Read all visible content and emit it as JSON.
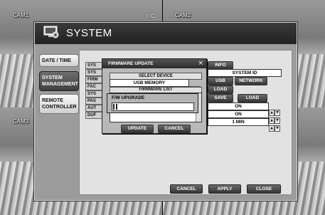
{
  "cameras": [
    "CAM1",
    "CAM2",
    "CAM3",
    "CAM4"
  ],
  "rec_indicator": "□ C",
  "window": {
    "title": "SYSTEM",
    "icon": "monitor-gear-icon"
  },
  "nav": [
    {
      "label": "DATE / TIME",
      "active": false
    },
    {
      "label": "SYSTEM MANAGEMENT",
      "active": true
    },
    {
      "label": "REMOTE CONTROLLER",
      "active": false
    }
  ],
  "rows": [
    "SYS",
    "SYS",
    "FIRM",
    "FAC",
    "SYS",
    "PAS",
    "AUT",
    "DUF"
  ],
  "right_panel": {
    "info_label": "INFO",
    "system_id_label": "SYSTEM ID",
    "usb_label": "USB",
    "network_label": "NETWORK",
    "load_label": "LOAD",
    "save_label": "SAVE",
    "load2_label": "LOAD",
    "on_value_1": "ON",
    "on_value_2": "ON",
    "duration_value": "1 MIN"
  },
  "footer": {
    "cancel": "CANCEL",
    "apply": "APPLY",
    "close": "CLOSE"
  },
  "firmware_dialog": {
    "title": "FIRMWARE UPDATE",
    "close_glyph": "×",
    "select_device_label": "SELECT DEVICE",
    "device_value": "USB MEMORY",
    "list_header": "FIRMWARE LIST",
    "update_button": "UPDATE",
    "cancel_button": "CANCEL"
  },
  "upgrade": {
    "label": "F/W UPGRADE",
    "progress": 0.06
  }
}
